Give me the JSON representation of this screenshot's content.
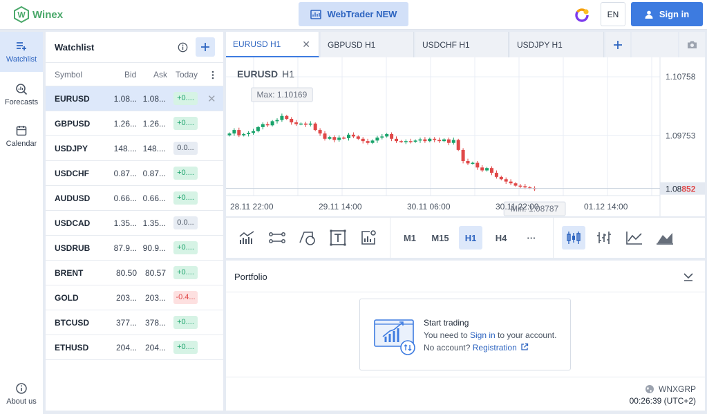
{
  "brand": {
    "name": "Winex",
    "logo_letter": "W",
    "color": "#4aa86a"
  },
  "header": {
    "webtrader_label": "WebTrader NEW",
    "lang": "EN",
    "signin_label": "Sign in"
  },
  "nav": [
    {
      "label": "Watchlist",
      "icon": "watchlist-add-icon",
      "active": true
    },
    {
      "label": "Forecasts",
      "icon": "forecast-search-icon"
    },
    {
      "label": "Calendar",
      "icon": "calendar-icon"
    },
    {
      "label": "About us",
      "icon": "info-icon"
    }
  ],
  "watchlist": {
    "title": "Watchlist",
    "columns": {
      "symbol": "Symbol",
      "bid": "Bid",
      "ask": "Ask",
      "today": "Today"
    },
    "rows": [
      {
        "symbol": "EURUSD",
        "bid": "1.08...",
        "ask": "1.08...",
        "change": "+0....",
        "dir": "up",
        "selected": true
      },
      {
        "symbol": "GBPUSD",
        "bid": "1.26...",
        "ask": "1.26...",
        "change": "+0....",
        "dir": "up"
      },
      {
        "symbol": "USDJPY",
        "bid": "148....",
        "ask": "148....",
        "change": "0.0...",
        "dir": "flat"
      },
      {
        "symbol": "USDCHF",
        "bid": "0.87...",
        "ask": "0.87...",
        "change": "+0....",
        "dir": "up"
      },
      {
        "symbol": "AUDUSD",
        "bid": "0.66...",
        "ask": "0.66...",
        "change": "+0....",
        "dir": "up"
      },
      {
        "symbol": "USDCAD",
        "bid": "1.35...",
        "ask": "1.35...",
        "change": "0.0...",
        "dir": "flat"
      },
      {
        "symbol": "USDRUB",
        "bid": "87.9...",
        "ask": "90.9...",
        "change": "+0....",
        "dir": "up"
      },
      {
        "symbol": "BRENT",
        "bid": "80.50",
        "ask": "80.57",
        "change": "+0....",
        "dir": "up"
      },
      {
        "symbol": "GOLD",
        "bid": "203...",
        "ask": "203...",
        "change": "-0.4...",
        "dir": "down"
      },
      {
        "symbol": "BTCUSD",
        "bid": "377...",
        "ask": "378...",
        "change": "+0....",
        "dir": "up"
      },
      {
        "symbol": "ETHUSD",
        "bid": "204...",
        "ask": "204...",
        "change": "+0....",
        "dir": "up"
      }
    ]
  },
  "tabs": [
    {
      "label": "EURUSD H1",
      "active": true
    },
    {
      "label": "GBPUSD H1"
    },
    {
      "label": "USDCHF H1"
    },
    {
      "label": "USDJPY H1"
    }
  ],
  "chart": {
    "symbol": "EURUSD",
    "timeframe": "H1",
    "max_label": "Max: 1.10169",
    "min_label": "Min: 1.08787",
    "y_ticks": [
      "1.10758",
      "1.09753"
    ],
    "price_main": "1.08",
    "price_tail": "852",
    "x_ticks": [
      "28.11 22:00",
      "29.11 14:00",
      "30.11 06:00",
      "30.11 22:00",
      "01.12 14:00"
    ],
    "up_color": "#1aa36b",
    "down_color": "#e04848"
  },
  "chart_data": {
    "type": "candlestick",
    "ylim": [
      1.0873,
      1.1109
    ],
    "y_ticks": [
      1.10758,
      1.09753
    ],
    "max": 1.10169,
    "min": 1.08787,
    "last": 1.08852,
    "closes": [
      1.0979,
      1.0985,
      1.0976,
      1.0978,
      1.098,
      1.0983,
      1.099,
      1.0995,
      1.0993,
      1.1,
      1.1002,
      1.1009,
      1.1004,
      1.0998,
      1.0995,
      1.0996,
      1.0994,
      1.0996,
      1.0985,
      1.0979,
      1.097,
      1.0973,
      1.0968,
      1.0972,
      1.0971,
      1.0977,
      1.0974,
      1.097,
      1.0966,
      1.0963,
      1.0967,
      1.0972,
      1.0974,
      1.0978,
      1.097,
      1.0966,
      1.0965,
      1.0966,
      1.0965,
      1.0967,
      1.0969,
      1.0966,
      1.097,
      1.0968,
      1.0966,
      1.0969,
      1.0963,
      1.0968,
      1.0951,
      1.0932,
      1.0928,
      1.0929,
      1.0921,
      1.0916,
      1.092,
      1.0912,
      1.0905,
      1.0901,
      1.0897,
      1.0894,
      1.089,
      1.0889,
      1.0887,
      1.0886,
      1.0885
    ]
  },
  "toolbar": {
    "tools": [
      "indicators-icon",
      "line-tool-icon",
      "shapes-icon",
      "text-tool-icon",
      "chart-settings-icon"
    ],
    "timeframes": [
      "M1",
      "M15",
      "H1",
      "H4",
      "···"
    ],
    "active_timeframe": "H1",
    "chart_types": [
      "candles-icon",
      "bars-icon",
      "line-chart-icon",
      "area-chart-icon"
    ]
  },
  "portfolio": {
    "title": "Portfolio",
    "start_title": "Start trading",
    "line1_pre": "You need to",
    "signin_link": "Sign in",
    "line1_post": "to your account.",
    "line2_pre": "No account?",
    "register_link": "Registration",
    "brand": "WNXGRP",
    "time": "00:26:39 (UTC+2)"
  },
  "colors": {
    "accent": "#3d7be0",
    "selected_bg": "#dde8fa"
  }
}
